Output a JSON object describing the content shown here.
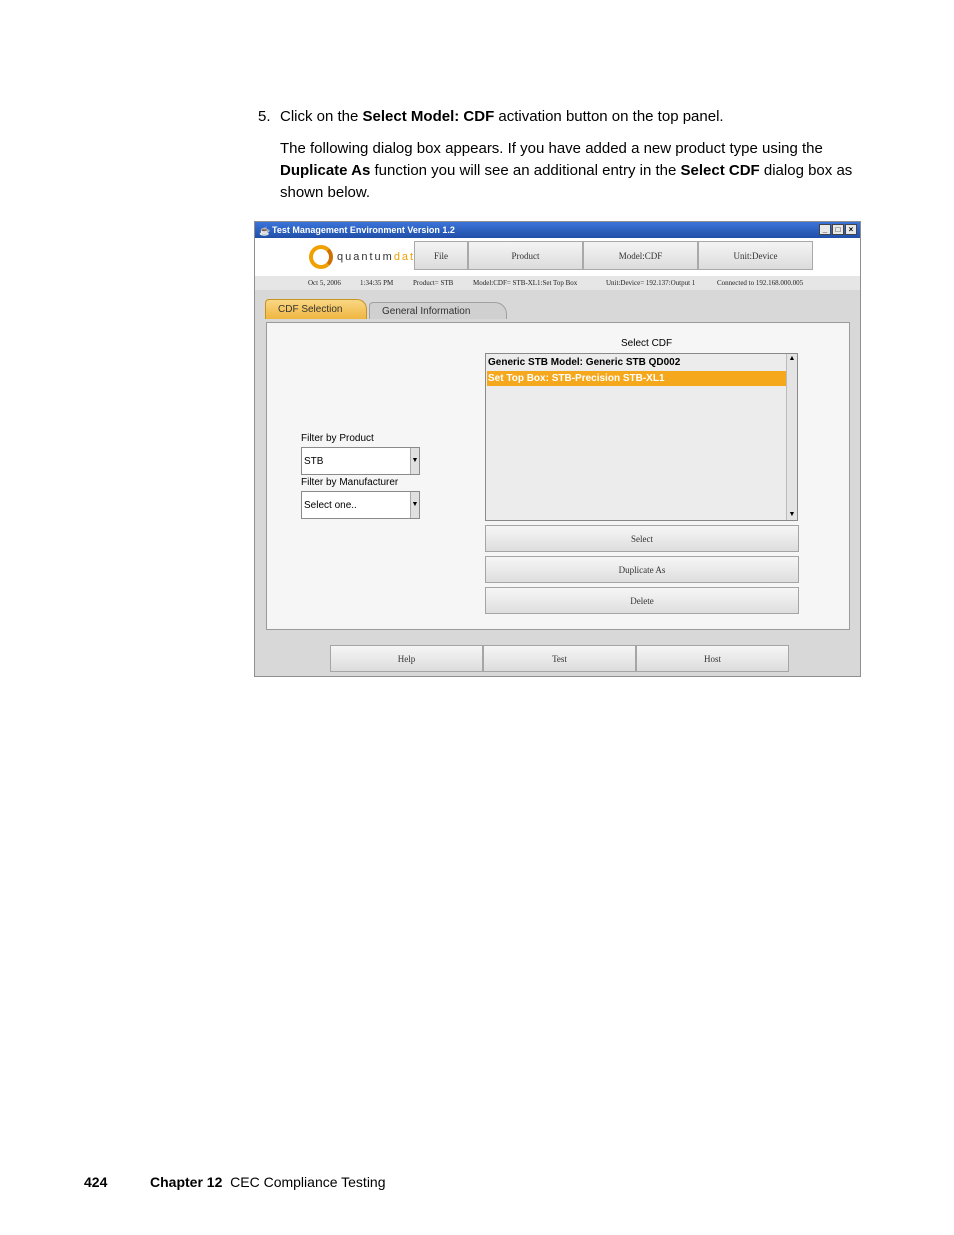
{
  "document": {
    "step_number": "5.",
    "step_prefix": "Click on the ",
    "step_bold": "Select Model: CDF",
    "step_suffix": " activation button on the top panel.",
    "para_part1": "The following dialog box appears. If you have added a new product type using the ",
    "para_bold1": "Duplicate As",
    "para_part2": " function you will see an additional entry in the ",
    "para_bold2": "Select CDF",
    "para_part3": " dialog box as shown below."
  },
  "window": {
    "title": "Test Management Environment Version 1.2",
    "controls": {
      "minimize": "_",
      "maximize": "□",
      "close": "×"
    },
    "logo_text_main": "quantum",
    "logo_text_accent": "data",
    "top_buttons": [
      "File",
      "Product",
      "Model:CDF",
      "Unit:Device"
    ],
    "status": {
      "date": "Oct 5, 2006",
      "time": "1:34:35 PM",
      "product": "Product= STB",
      "model": "Model:CDF= STB-XL1:Set Top Box",
      "unit": "Unit:Device= 192.137:Output 1",
      "connected": "Connected to 192.168.000.005"
    },
    "tabs": {
      "active": "CDF Selection",
      "inactive": "General Information"
    },
    "filter_product_label": "Filter by Product",
    "filter_product_value": "STB",
    "filter_manufacturer_label": "Filter by Manufacturer",
    "filter_manufacturer_value": "Select one..",
    "select_cdf_label": "Select CDF",
    "cdf_list": [
      "Generic STB Model: Generic STB QD002",
      "Set Top Box: STB-Precision STB-XL1"
    ],
    "action_buttons": [
      "Select",
      "Duplicate As",
      "Delete"
    ],
    "bottom_buttons": [
      "Help",
      "Test",
      "Host"
    ]
  },
  "footer": {
    "page_number": "424",
    "chapter_label": "Chapter 12",
    "chapter_title": "CEC Compliance Testing"
  },
  "colors": {
    "selected_row": "#f5a81c",
    "active_tab": "#f0b640",
    "title_bar": "#1f4fa8"
  }
}
